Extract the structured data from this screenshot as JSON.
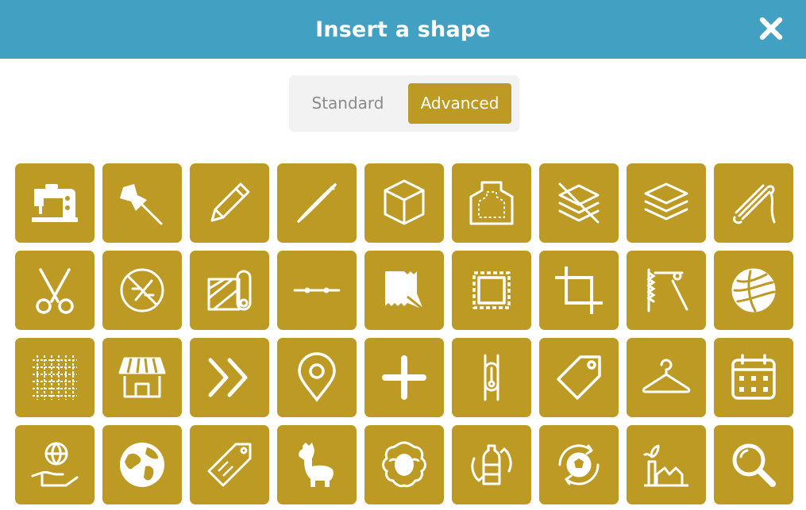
{
  "dialog": {
    "title": "Insert a shape",
    "close_icon": "close-icon"
  },
  "tabs": {
    "standard": "Standard",
    "advanced": "Advanced",
    "selected": "Advanced"
  },
  "colors": {
    "header": "#42a0c3",
    "tile": "#bd9a24",
    "toggle_bg": "#f2f2f2",
    "inactive_text": "#8a8a8a"
  },
  "shapes": [
    "sewing-machine-icon",
    "pushpin-icon",
    "pencil-icon",
    "needle-icon",
    "cube-icon",
    "apron-pattern-icon",
    "no-layers-icon",
    "layers-icon",
    "yarn-skein-icon",
    "scissors-icon",
    "no-sewing-icon",
    "fabric-roll-icon",
    "stitch-line-icon",
    "fabric-swatch-icon",
    "stamp-frame-icon",
    "crop-icon",
    "hand-sewing-icon",
    "yarn-ball-icon",
    "mesh-fabric-icon",
    "shop-icon",
    "double-chevron-icon",
    "location-pin-icon",
    "plus-icon",
    "zipper-icon",
    "price-tag-icon",
    "hanger-icon",
    "calendar-icon",
    "globe-hand-icon",
    "earth-icon",
    "eco-tag-icon",
    "alpaca-icon",
    "sheep-icon",
    "bottle-recycle-icon",
    "ball-recycle-icon",
    "factory-plant-icon",
    "magnifier-icon"
  ]
}
